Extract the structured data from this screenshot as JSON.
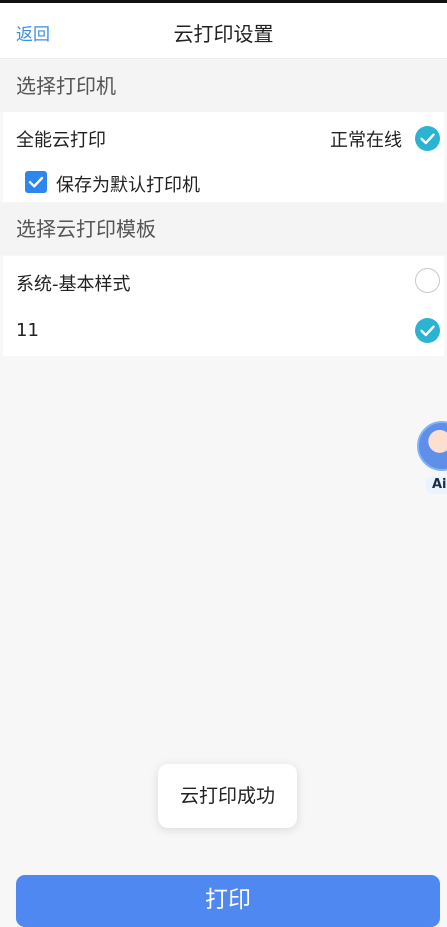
{
  "header": {
    "back_label": "返回",
    "title": "云打印设置"
  },
  "printer_section": {
    "title": "选择打印机",
    "printer": {
      "name": "全能云打印",
      "status": "正常在线",
      "selected": true
    },
    "default_checkbox": {
      "label": "保存为默认打印机",
      "checked": true
    }
  },
  "template_section": {
    "title": "选择云打印模板",
    "templates": [
      {
        "name": "系统-基本样式",
        "selected": false
      },
      {
        "name": "11",
        "selected": true
      }
    ]
  },
  "assistant": {
    "tag": "Ai"
  },
  "toast": {
    "message": "云打印成功"
  },
  "footer": {
    "print_label": "打印"
  },
  "colors": {
    "accent": "#2bb3d3",
    "button": "#4f88f0",
    "link": "#3b8ee8"
  }
}
